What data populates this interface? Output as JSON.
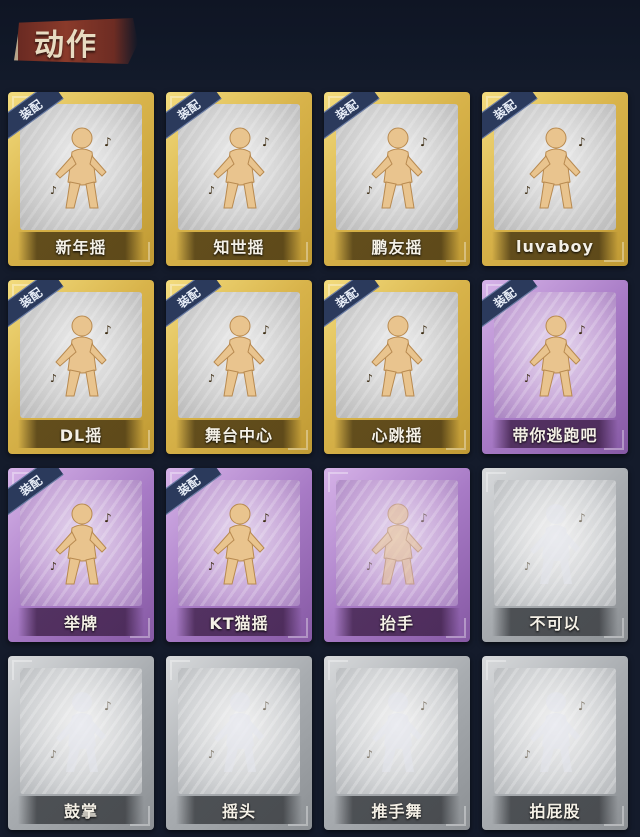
{
  "header": {
    "title": "动作"
  },
  "badge_label": "装配",
  "actions": [
    {
      "name": "新年摇",
      "rarity": "gold",
      "equipped": true,
      "icon": "new-year-dance-icon"
    },
    {
      "name": "知世摇",
      "rarity": "gold",
      "equipped": true,
      "icon": "dance-icon"
    },
    {
      "name": "鹏友摇",
      "rarity": "gold",
      "equipped": true,
      "icon": "dance-icon"
    },
    {
      "name": "luvaboy",
      "rarity": "gold",
      "equipped": true,
      "icon": "dance-icon"
    },
    {
      "name": "DL摇",
      "rarity": "gold",
      "equipped": true,
      "icon": "arm-raise-dance-icon"
    },
    {
      "name": "舞台中心",
      "rarity": "gold",
      "equipped": true,
      "icon": "stage-center-icon"
    },
    {
      "name": "心跳摇",
      "rarity": "gold",
      "equipped": true,
      "icon": "heartbeat-dance-icon"
    },
    {
      "name": "带你逃跑吧",
      "rarity": "purple",
      "equipped": true,
      "icon": "point-dance-icon"
    },
    {
      "name": "举牌",
      "rarity": "purple",
      "equipped": true,
      "icon": "hold-sign-icon"
    },
    {
      "name": "KT猫摇",
      "rarity": "purple",
      "equipped": true,
      "icon": "cat-dance-icon"
    },
    {
      "name": "抬手",
      "rarity": "purple",
      "equipped": false,
      "icon": "raise-hand-icon"
    },
    {
      "name": "不可以",
      "rarity": "gray",
      "equipped": false,
      "icon": "finger-wag-icon"
    },
    {
      "name": "鼓掌",
      "rarity": "gray",
      "equipped": false,
      "icon": "clap-icon"
    },
    {
      "name": "摇头",
      "rarity": "gray",
      "equipped": false,
      "icon": "head-shake-icon"
    },
    {
      "name": "推手舞",
      "rarity": "gray",
      "equipped": false,
      "icon": "push-dance-icon"
    },
    {
      "name": "拍屁股",
      "rarity": "gray",
      "equipped": false,
      "icon": "butt-slap-icon"
    }
  ],
  "colors": {
    "gold": "#d8b34a",
    "purple": "#a87bc6",
    "gray": "#a8acb0",
    "badge": "#2b3a5c"
  }
}
